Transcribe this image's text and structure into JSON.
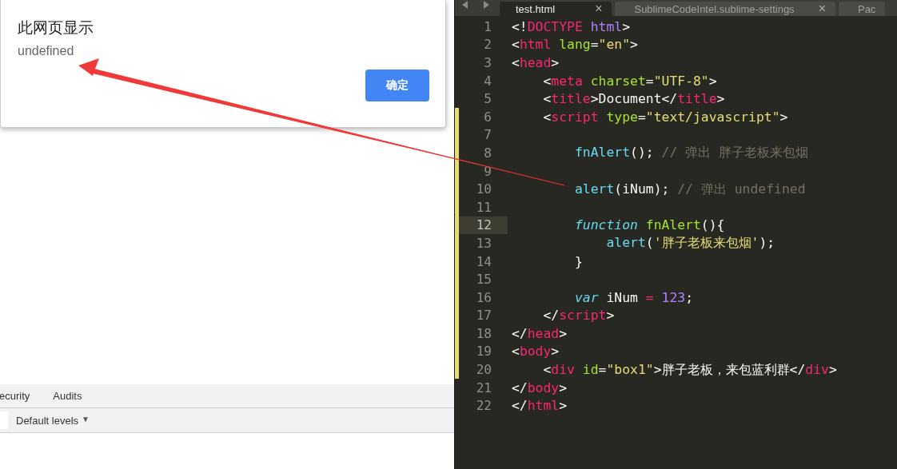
{
  "dialog": {
    "title": "此网页显示",
    "message": "undefined",
    "button": "确定"
  },
  "devtools": {
    "tabs": [
      {
        "label": "ecurity",
        "selected": false
      },
      {
        "label": "Audits",
        "selected": false
      }
    ],
    "levels": "Default levels",
    "levels_caret": "▼"
  },
  "editor": {
    "tabs": [
      {
        "label": "test.html",
        "close": "×",
        "selected": true
      },
      {
        "label": "SublimeCodeIntel.sublime-settings",
        "close": "×",
        "selected": false
      },
      {
        "label": "Pac",
        "selected": false
      }
    ],
    "lines": [
      {
        "number": "1",
        "modified": false,
        "current": false,
        "tokens": [
          {
            "kind": "punct",
            "text": "<!"
          },
          {
            "kind": "tag",
            "text": "DOCTYPE"
          },
          {
            "kind": "number",
            "text": " html"
          },
          {
            "kind": "punct",
            "text": ">"
          }
        ]
      },
      {
        "number": "2",
        "modified": false,
        "current": false,
        "tokens": [
          {
            "kind": "punct",
            "text": "<"
          },
          {
            "kind": "tag",
            "text": "html"
          },
          {
            "kind": "attr",
            "text": " lang"
          },
          {
            "kind": "punct",
            "text": "="
          },
          {
            "kind": "string",
            "text": "\"en\""
          },
          {
            "kind": "punct",
            "text": ">"
          }
        ]
      },
      {
        "number": "3",
        "modified": false,
        "current": false,
        "tokens": [
          {
            "kind": "punct",
            "text": "<"
          },
          {
            "kind": "tag",
            "text": "head"
          },
          {
            "kind": "punct",
            "text": ">"
          }
        ]
      },
      {
        "number": "4",
        "modified": false,
        "current": false,
        "tokens": [
          {
            "kind": "punct",
            "text": "    <"
          },
          {
            "kind": "tag",
            "text": "meta"
          },
          {
            "kind": "attr",
            "text": " charset"
          },
          {
            "kind": "punct",
            "text": "="
          },
          {
            "kind": "string",
            "text": "\"UTF-8\""
          },
          {
            "kind": "punct",
            "text": ">"
          }
        ]
      },
      {
        "number": "5",
        "modified": false,
        "current": false,
        "tokens": [
          {
            "kind": "punct",
            "text": "    <"
          },
          {
            "kind": "tag",
            "text": "title"
          },
          {
            "kind": "punct",
            "text": ">Document</"
          },
          {
            "kind": "tag",
            "text": "title"
          },
          {
            "kind": "punct",
            "text": ">"
          }
        ]
      },
      {
        "number": "6",
        "modified": true,
        "current": false,
        "tokens": [
          {
            "kind": "punct",
            "text": "    <"
          },
          {
            "kind": "tag",
            "text": "script"
          },
          {
            "kind": "attr",
            "text": " type"
          },
          {
            "kind": "punct",
            "text": "="
          },
          {
            "kind": "string",
            "text": "\"text/javascript\""
          },
          {
            "kind": "punct",
            "text": ">"
          }
        ]
      },
      {
        "number": "7",
        "modified": true,
        "current": false
      },
      {
        "number": "8",
        "modified": true,
        "current": false,
        "tokens": [
          {
            "kind": "func",
            "text": "        fnAlert"
          },
          {
            "kind": "punct",
            "text": "(); "
          },
          {
            "kind": "comment",
            "text": "// 弹出 胖子老板来包烟"
          }
        ]
      },
      {
        "number": "9",
        "modified": true,
        "current": false
      },
      {
        "number": "10",
        "modified": true,
        "current": false,
        "tokens": [
          {
            "kind": "func",
            "text": "        alert"
          },
          {
            "kind": "punct",
            "text": "(iNum); "
          },
          {
            "kind": "comment",
            "text": "// 弹出 undefined"
          }
        ]
      },
      {
        "number": "11",
        "modified": true,
        "current": false
      },
      {
        "number": "12",
        "modified": true,
        "current": true,
        "tokens": [
          {
            "kind": "keyword",
            "text": "        function"
          },
          {
            "kind": "attr",
            "text": " fnAlert"
          },
          {
            "kind": "punct",
            "text": "(){"
          }
        ]
      },
      {
        "number": "13",
        "modified": true,
        "current": false,
        "tokens": [
          {
            "kind": "func",
            "text": "            alert"
          },
          {
            "kind": "punct",
            "text": "("
          },
          {
            "kind": "string",
            "text": "'胖子老板来包烟'"
          },
          {
            "kind": "punct",
            "text": ");"
          }
        ]
      },
      {
        "number": "14",
        "modified": true,
        "current": false,
        "tokens": [
          {
            "kind": "punct",
            "text": "        }"
          }
        ]
      },
      {
        "number": "15",
        "modified": true,
        "current": false
      },
      {
        "number": "16",
        "modified": true,
        "current": false,
        "tokens": [
          {
            "kind": "keyword",
            "text": "        var"
          },
          {
            "kind": "punct",
            "text": " iNum "
          },
          {
            "kind": "tag",
            "text": "="
          },
          {
            "kind": "number",
            "text": " 123"
          },
          {
            "kind": "punct",
            "text": ";"
          }
        ]
      },
      {
        "number": "17",
        "modified": true,
        "current": false,
        "tokens": [
          {
            "kind": "punct",
            "text": "    </"
          },
          {
            "kind": "tag",
            "text": "script"
          },
          {
            "kind": "punct",
            "text": ">"
          }
        ]
      },
      {
        "number": "18",
        "modified": true,
        "current": false,
        "tokens": [
          {
            "kind": "punct",
            "text": "</"
          },
          {
            "kind": "tag",
            "text": "head"
          },
          {
            "kind": "punct",
            "text": ">"
          }
        ]
      },
      {
        "number": "19",
        "modified": true,
        "current": false,
        "tokens": [
          {
            "kind": "punct",
            "text": "<"
          },
          {
            "kind": "tag",
            "text": "body"
          },
          {
            "kind": "punct",
            "text": ">"
          }
        ]
      },
      {
        "number": "20",
        "modified": true,
        "current": false,
        "tokens": [
          {
            "kind": "punct",
            "text": "    <"
          },
          {
            "kind": "tag",
            "text": "div"
          },
          {
            "kind": "attr",
            "text": " id"
          },
          {
            "kind": "punct",
            "text": "="
          },
          {
            "kind": "string",
            "text": "\"box1\""
          },
          {
            "kind": "punct",
            "text": ">胖子老板，来包蓝利群</"
          },
          {
            "kind": "tag",
            "text": "div"
          },
          {
            "kind": "punct",
            "text": ">"
          }
        ]
      },
      {
        "number": "21",
        "modified": false,
        "current": false,
        "tokens": [
          {
            "kind": "punct",
            "text": "</"
          },
          {
            "kind": "tag",
            "text": "body"
          },
          {
            "kind": "punct",
            "text": ">"
          }
        ]
      },
      {
        "number": "22",
        "modified": false,
        "current": false,
        "tokens": [
          {
            "kind": "punct",
            "text": "</"
          },
          {
            "kind": "tag",
            "text": "html"
          },
          {
            "kind": "punct",
            "text": ">"
          }
        ]
      }
    ]
  }
}
